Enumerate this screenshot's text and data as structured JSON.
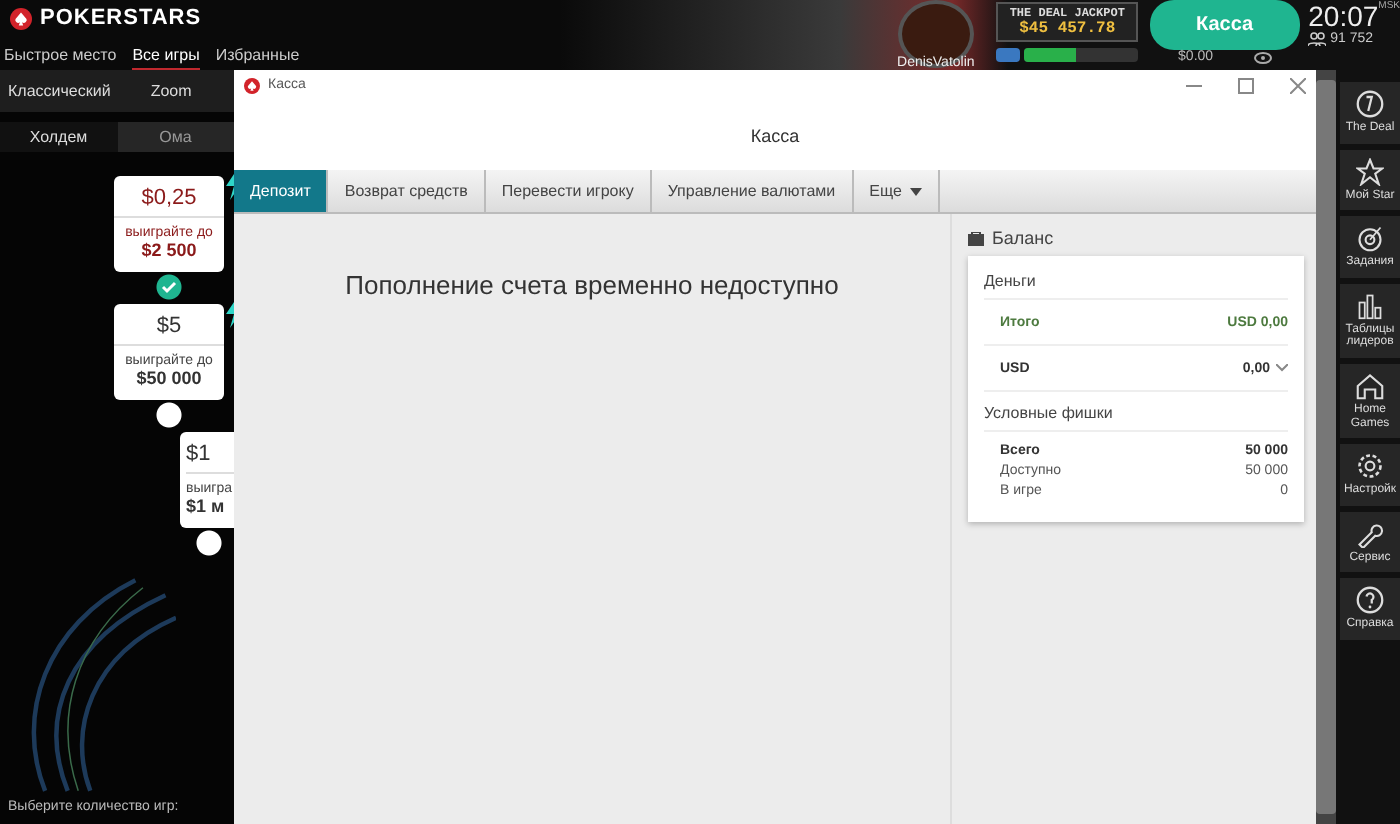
{
  "app": {
    "logo": "POKERSTARS",
    "nav": [
      {
        "label": "Быстрое место",
        "selected": false
      },
      {
        "label": "Все игры",
        "selected": true
      },
      {
        "label": "Избранные",
        "selected": false
      }
    ],
    "modes": [
      {
        "label": "Классический",
        "selected": false
      },
      {
        "label": "Zoom",
        "selected": false
      }
    ],
    "game_tabs": [
      {
        "label": "Холдем",
        "selected": true
      },
      {
        "label": "Ома",
        "selected": false
      }
    ],
    "offers": [
      {
        "kind": "full",
        "stake": "$0,25",
        "caption": "выиграйте до",
        "prize": "$2 500",
        "selected": true
      },
      {
        "kind": "full",
        "stake": "$5",
        "caption": "выиграйте до",
        "prize": "$50 000",
        "selected": false
      },
      {
        "kind": "cut",
        "stake": "$1",
        "caption": "выигра",
        "prize": "$1 м",
        "selected": false
      }
    ],
    "footer_label": "Выберите количество игр:"
  },
  "header": {
    "username": "DenisVatolin",
    "jackpot_title": "THE DEAL JACKPOT",
    "jackpot_amount": "$45 457.78",
    "jackpot_progress": {
      "level": 0.45
    },
    "cashier_button": "Касса",
    "balance": "$0.00",
    "time": "20:07",
    "timezone": "MSK",
    "players": "91 752"
  },
  "sidebar": [
    {
      "kind": "deal",
      "label": "The Deal"
    },
    {
      "kind": "star",
      "label": "Мой Star"
    },
    {
      "kind": "target",
      "label": "Задания"
    },
    {
      "kind": "chart",
      "label": "Таблицы лидеров"
    },
    {
      "kind": "home",
      "label": "Home Games"
    },
    {
      "kind": "gear",
      "label": "Настройк"
    },
    {
      "kind": "wrench",
      "label": "Сервис"
    },
    {
      "kind": "help",
      "label": "Справка"
    }
  ],
  "cashier": {
    "window_title": "Касса",
    "heading": "Касса",
    "tabs": [
      {
        "kind": "tab",
        "label": "Депозит",
        "selected": true
      },
      {
        "kind": "tab",
        "label": "Возврат средств",
        "selected": false
      },
      {
        "kind": "tab",
        "label": "Перевести игроку",
        "selected": false
      },
      {
        "kind": "tab",
        "label": "Управление валютами",
        "selected": false
      },
      {
        "kind": "menu",
        "label": "Еще",
        "selected": false
      }
    ],
    "message": "Пополнение счета временно недоступно",
    "balance": {
      "title": "Баланс",
      "sections": [
        {
          "title": "Деньги",
          "rows": [
            {
              "kind": "total",
              "label": "Итого",
              "value": "USD 0,00"
            },
            {
              "kind": "currency",
              "label": "USD",
              "value": "0,00"
            }
          ]
        },
        {
          "title": "Условные фишки",
          "rows": [
            {
              "kind": "strong",
              "label": "Всего",
              "value": "50 000"
            },
            {
              "kind": "plain",
              "label": "Доступно",
              "value": "50 000"
            },
            {
              "kind": "plain",
              "label": "В игре",
              "value": "0"
            }
          ]
        }
      ]
    }
  }
}
